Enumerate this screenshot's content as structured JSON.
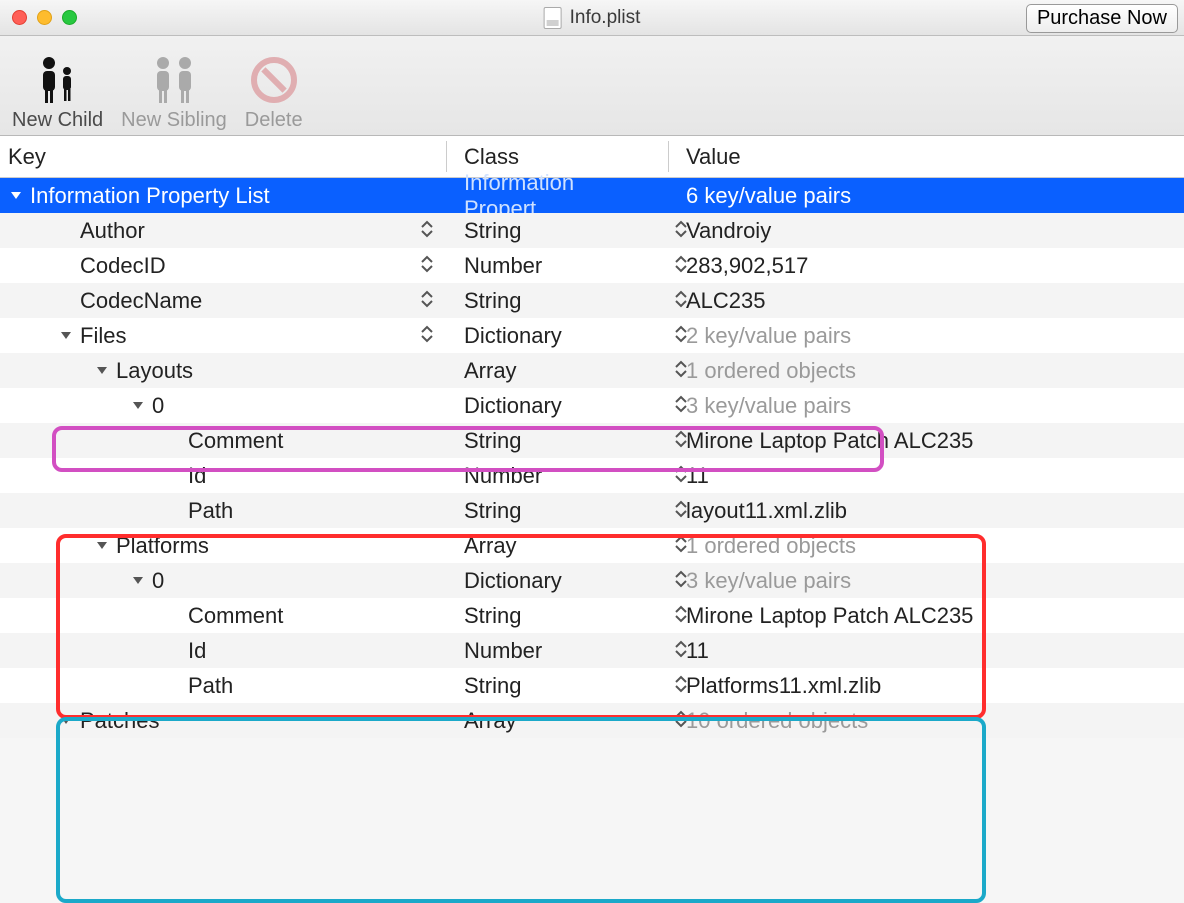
{
  "window": {
    "title": "Info.plist",
    "purchase_label": "Purchase Now"
  },
  "toolbar": {
    "new_child": "New Child",
    "new_sibling": "New Sibling",
    "delete": "Delete"
  },
  "columns": {
    "key": "Key",
    "class": "Class",
    "value": "Value"
  },
  "rows": [
    {
      "key": "Information Property List",
      "class": "Information Propert…",
      "value": "6 key/value pairs",
      "indent": 0,
      "disclosure": "down",
      "selected": true,
      "key_stepper": false,
      "val_stepper": false,
      "grey_value": false
    },
    {
      "key": "Author",
      "class": "String",
      "value": "Vandroiy",
      "indent": 1,
      "disclosure": "none",
      "selected": false,
      "key_stepper": true,
      "val_stepper": true,
      "grey_value": false
    },
    {
      "key": "CodecID",
      "class": "Number",
      "value": "283,902,517",
      "indent": 1,
      "disclosure": "none",
      "selected": false,
      "key_stepper": true,
      "val_stepper": true,
      "grey_value": false
    },
    {
      "key": "CodecName",
      "class": "String",
      "value": "ALC235",
      "indent": 1,
      "disclosure": "none",
      "selected": false,
      "key_stepper": true,
      "val_stepper": true,
      "grey_value": false
    },
    {
      "key": "Files",
      "class": "Dictionary",
      "value": "2 key/value pairs",
      "indent": 1,
      "disclosure": "down",
      "selected": false,
      "key_stepper": true,
      "val_stepper": true,
      "grey_value": true
    },
    {
      "key": "Layouts",
      "class": "Array",
      "value": "1 ordered objects",
      "indent": 2,
      "disclosure": "down",
      "selected": false,
      "key_stepper": false,
      "val_stepper": true,
      "grey_value": true
    },
    {
      "key": "0",
      "class": "Dictionary",
      "value": "3 key/value pairs",
      "indent": 3,
      "disclosure": "down",
      "selected": false,
      "key_stepper": false,
      "val_stepper": true,
      "grey_value": true
    },
    {
      "key": "Comment",
      "class": "String",
      "value": "Mirone Laptop Patch ALC235",
      "indent": 4,
      "disclosure": "none",
      "selected": false,
      "key_stepper": false,
      "val_stepper": true,
      "grey_value": false
    },
    {
      "key": "Id",
      "class": "Number",
      "value": "11",
      "indent": 4,
      "disclosure": "none",
      "selected": false,
      "key_stepper": false,
      "val_stepper": true,
      "grey_value": false
    },
    {
      "key": "Path",
      "class": "String",
      "value": "layout11.xml.zlib",
      "indent": 4,
      "disclosure": "none",
      "selected": false,
      "key_stepper": false,
      "val_stepper": true,
      "grey_value": false
    },
    {
      "key": "Platforms",
      "class": "Array",
      "value": "1 ordered objects",
      "indent": 2,
      "disclosure": "down",
      "selected": false,
      "key_stepper": false,
      "val_stepper": true,
      "grey_value": true
    },
    {
      "key": "0",
      "class": "Dictionary",
      "value": "3 key/value pairs",
      "indent": 3,
      "disclosure": "down",
      "selected": false,
      "key_stepper": false,
      "val_stepper": true,
      "grey_value": true
    },
    {
      "key": "Comment",
      "class": "String",
      "value": "Mirone Laptop Patch ALC235",
      "indent": 4,
      "disclosure": "none",
      "selected": false,
      "key_stepper": false,
      "val_stepper": true,
      "grey_value": false
    },
    {
      "key": "Id",
      "class": "Number",
      "value": "11",
      "indent": 4,
      "disclosure": "none",
      "selected": false,
      "key_stepper": false,
      "val_stepper": true,
      "grey_value": false
    },
    {
      "key": "Path",
      "class": "String",
      "value": "Platforms11.xml.zlib",
      "indent": 4,
      "disclosure": "none",
      "selected": false,
      "key_stepper": false,
      "val_stepper": true,
      "grey_value": false
    },
    {
      "key": "Patches",
      "class": "Array",
      "value": "10 ordered objects",
      "indent": 1,
      "disclosure": "down",
      "selected": false,
      "key_stepper": false,
      "val_stepper": true,
      "grey_value": true
    }
  ]
}
